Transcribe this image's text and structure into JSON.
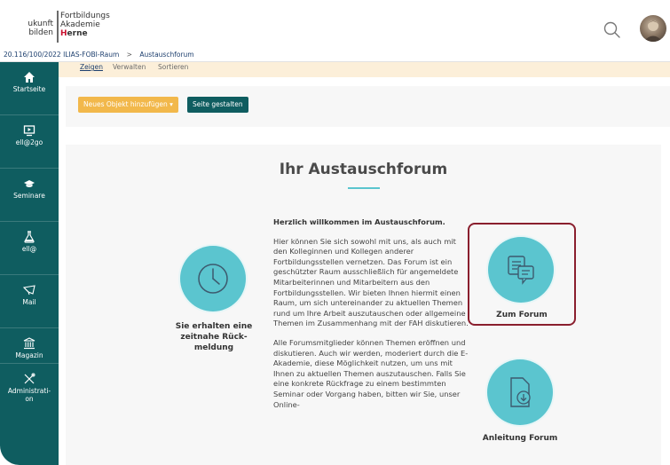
{
  "header": {
    "logo_left_line1": "ukunft",
    "logo_left_line2": "bilden",
    "logo_right_line1": "Fortbildungs",
    "logo_right_line2": "Akademie",
    "logo_right_line3_red": "H",
    "logo_right_line3_rest": "erne",
    "search_icon": "search-icon",
    "avatar": "user-avatar"
  },
  "breadcrumb": {
    "item1": "20.116/100/2022 ILIAS-FOBI-Raum",
    "separator": ">",
    "item2": "Austauschforum"
  },
  "sidebar": {
    "items": [
      {
        "label": "Startseite",
        "icon": "home-icon"
      },
      {
        "label": "ell@2go",
        "icon": "presentation-icon"
      },
      {
        "label": "Seminare",
        "icon": "graduation-cap-icon"
      },
      {
        "label": "ell@",
        "icon": "flask-icon"
      },
      {
        "label": "Mail",
        "icon": "mail-icon"
      },
      {
        "label": "Magazin",
        "icon": "bank-icon"
      },
      {
        "label": "Administrati-\non",
        "icon": "tools-icon"
      }
    ]
  },
  "subtabs": {
    "zeigen": "Zeigen",
    "verwalten": "Verwalten",
    "sortieren": "Sortieren"
  },
  "toolbar": {
    "add_object": "Neues Objekt hinzufügen ▾",
    "page_design": "Seite gestalten"
  },
  "panel": {
    "title": "Ihr Austauschforum",
    "left_caption": "Sie erhalten eine\nzeitnahe Rück-\nmeldung",
    "intro_heading": "Herzlich willkommen im Austauschforum.",
    "paragraph1": "Hier können Sie sich sowohl mit uns, als auch mit den Kolleginnen und Kollegen anderer Fortbildungsstellen vernetzen. Das Forum ist ein geschützter Raum ausschließlich für angemeldete Mitarbeiterinnen und Mitarbeitern aus den Fortbildungsstellen. Wir bieten Ihnen hiermit einen Raum, um sich untereinander zu aktuellen Themen rund um Ihre Arbeit auszutauschen oder allgemeine Themen im Zusammenhang mit der FAH diskutieren.",
    "paragraph2": "Alle Forumsmitglieder können Themen eröffnen und diskutieren. Auch wir werden, moderiert durch die E-Akademie, diese Möglichkeit nutzen, um uns mit Ihnen zu aktuellen Themen auszutauschen. Falls Sie eine konkrete Rückfrage zu einem bestimmten Seminar oder Vorgang haben, bitten wir Sie, unser Online-",
    "forum_caption": "Zum Forum",
    "guide_caption": "Anleitung Forum"
  },
  "colors": {
    "sidebar": "#0f5d60",
    "accent": "#5bc5cf",
    "highlight_border": "#8a1f2e",
    "add_button": "#f2b84b"
  }
}
